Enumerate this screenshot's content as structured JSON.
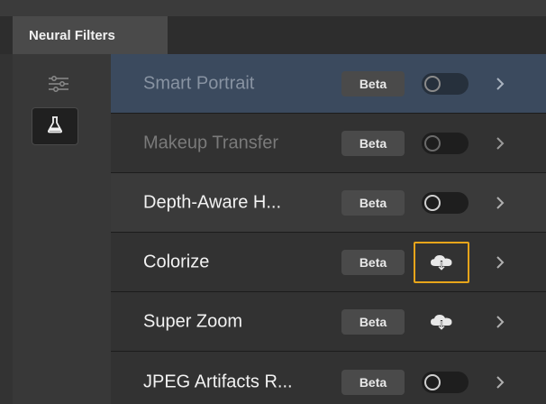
{
  "panel": {
    "tab_label": "Neural Filters"
  },
  "sidebar": {
    "items": [
      {
        "icon": "sliders-icon",
        "active": false
      },
      {
        "icon": "flask-icon",
        "active": true
      }
    ]
  },
  "filters": [
    {
      "label": "Smart Portrait",
      "badge": "Beta",
      "control": "toggle",
      "state": "off",
      "dimmed": true,
      "selected": true
    },
    {
      "label": "Makeup Transfer",
      "badge": "Beta",
      "control": "toggle",
      "state": "off",
      "dimmed": true,
      "selected": false
    },
    {
      "label": "Depth-Aware H...",
      "badge": "Beta",
      "control": "toggle",
      "state": "off",
      "dimmed": false,
      "selected": false
    },
    {
      "label": "Colorize",
      "badge": "Beta",
      "control": "cloud-download",
      "state": "focused",
      "dimmed": false,
      "selected": false
    },
    {
      "label": "Super Zoom",
      "badge": "Beta",
      "control": "cloud-download",
      "state": "normal",
      "dimmed": false,
      "selected": false
    },
    {
      "label": "JPEG Artifacts R...",
      "badge": "Beta",
      "control": "toggle",
      "state": "off",
      "dimmed": false,
      "selected": false
    }
  ],
  "colors": {
    "selected_row": "#3b4a5e",
    "focus_ring": "#e8a51a",
    "row_dark": "#323232",
    "row_mid": "#3a3a3a"
  }
}
